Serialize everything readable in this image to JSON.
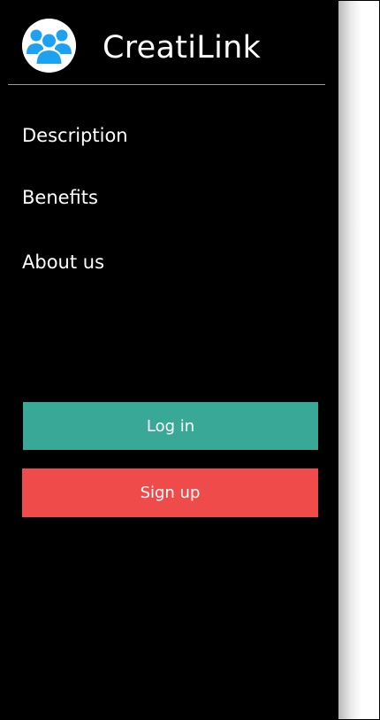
{
  "app": {
    "name": "CreatiLink",
    "logo_icon": "users-group-icon",
    "logo_color": "#1da1f2"
  },
  "nav": {
    "items": [
      {
        "label": "Description"
      },
      {
        "label": "Benefits"
      },
      {
        "label": "About us"
      }
    ]
  },
  "actions": {
    "login_label": "Log in",
    "login_color": "#3aa897",
    "signup_label": "Sign up",
    "signup_color": "#ef4b4b"
  }
}
